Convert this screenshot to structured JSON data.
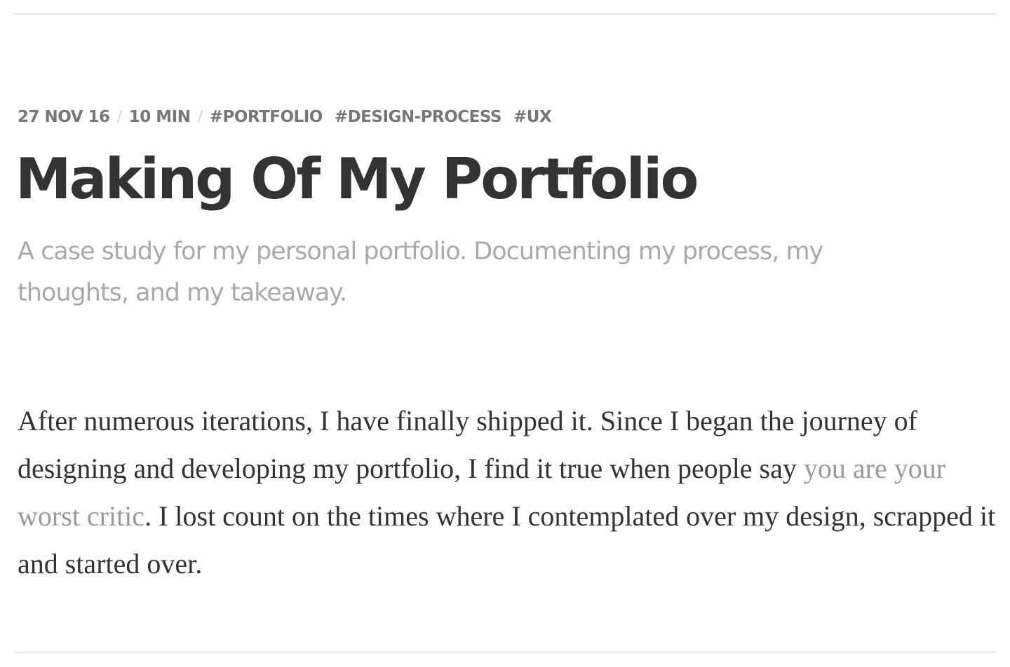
{
  "post": {
    "meta": {
      "date": "27 NOV 16",
      "separator": "/",
      "read_time": "10 MIN",
      "tags": [
        "#PORTFOLIO",
        "#DESIGN-PROCESS",
        "#UX"
      ]
    },
    "title": "Making Of My Portfolio",
    "subtitle": "A case study for my personal portfolio. Documenting my process, my thoughts, and my takeaway.",
    "body": {
      "part1": "After numerous iterations, I have finally shipped it. Since I began the journey of designing and developing my portfolio, I find it true when people say ",
      "highlight": "you are your worst critic",
      "part2": ". I lost count on the times where I contemplated over my design, scrapped it and started over."
    }
  },
  "colors": {
    "text": "#333333",
    "meta": "#777777",
    "subtitle": "#a9a9a9",
    "highlight": "#9a9a9a",
    "rule": "#e9e9e9"
  }
}
